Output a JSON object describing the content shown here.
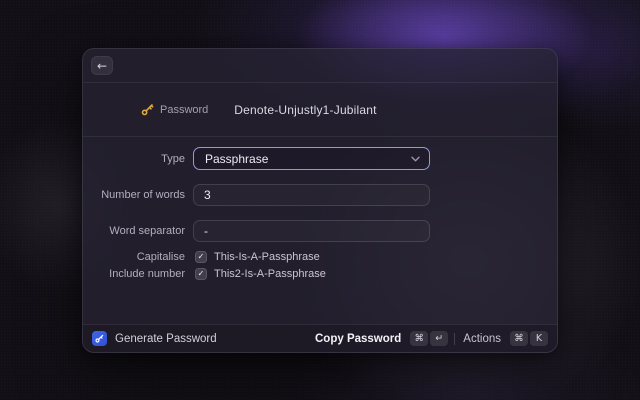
{
  "colors": {
    "accent-border": "#9298dd",
    "key-gold": "#e0a83c",
    "app-blue": "#3d64e6"
  },
  "header": {
    "back_icon": "←"
  },
  "summary": {
    "icon": "key-icon",
    "label": "Password",
    "value": "Denote-Unjustly1-Jubilant"
  },
  "form": {
    "type": {
      "label": "Type",
      "value": "Passphrase"
    },
    "words": {
      "label": "Number of words",
      "value": "3"
    },
    "separator": {
      "label": "Word separator",
      "value": "-"
    },
    "capitalise": {
      "label": "Capitalise",
      "checked": "✓",
      "text": "This-Is-A-Passphrase"
    },
    "include_number": {
      "label": "Include number",
      "checked": "✓",
      "text": "This2-Is-A-Passphrase"
    }
  },
  "footer": {
    "icon": "password-app-icon",
    "title": "Generate Password",
    "primary": {
      "label": "Copy Password",
      "keys": [
        "⌘",
        "↵"
      ]
    },
    "secondary": {
      "label": "Actions",
      "keys": [
        "⌘",
        "K"
      ]
    }
  }
}
